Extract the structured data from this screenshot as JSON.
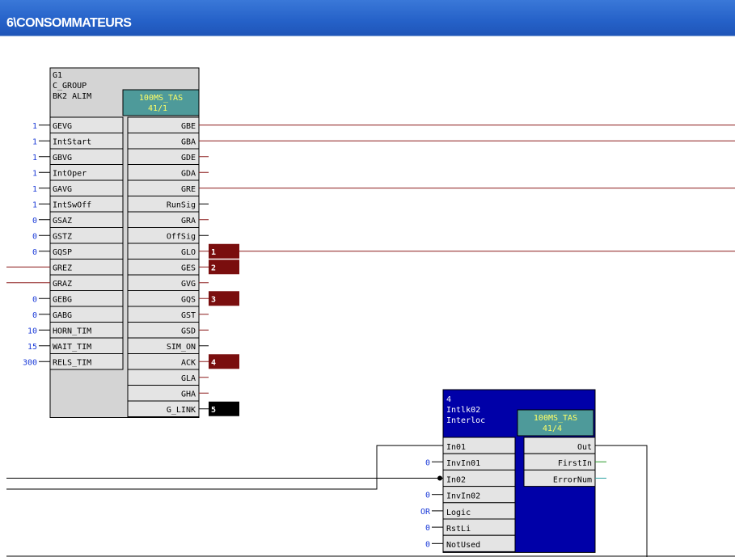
{
  "window": {
    "title": "6\\CONSOMMATEURS"
  },
  "blocks": {
    "g1": {
      "header": [
        "G1",
        "C_GROUP",
        "BK2 ALIM"
      ],
      "task": [
        "100MS_TAS",
        "41/1"
      ],
      "inputs": [
        {
          "name": "GEVG",
          "value": "1"
        },
        {
          "name": "IntStart",
          "value": "1"
        },
        {
          "name": "GBVG",
          "value": "1"
        },
        {
          "name": "IntOper",
          "value": "1"
        },
        {
          "name": "GAVG",
          "value": "1"
        },
        {
          "name": "IntSwOff",
          "value": "1"
        },
        {
          "name": "GSAZ",
          "value": "0"
        },
        {
          "name": "GSTZ",
          "value": "0"
        },
        {
          "name": "GQSP",
          "value": "0"
        },
        {
          "name": "GREZ",
          "value": ""
        },
        {
          "name": "GRAZ",
          "value": ""
        },
        {
          "name": "GEBG",
          "value": "0"
        },
        {
          "name": "GABG",
          "value": "0"
        },
        {
          "name": "HORN_TIM",
          "value": "10"
        },
        {
          "name": "WAIT_TIM",
          "value": "15"
        },
        {
          "name": "RELS_TIM",
          "value": "300"
        }
      ],
      "outputs": [
        "GBE",
        "GBA",
        "GDE",
        "GDA",
        "GRE",
        "RunSig",
        "GRA",
        "OffSig",
        "GLO",
        "GES",
        "GVG",
        "GQS",
        "GST",
        "GSD",
        "SIM_ON",
        "ACK",
        "GLA",
        "GHA",
        "G_LINK"
      ],
      "markers": [
        {
          "pin": "GLO",
          "label": "1"
        },
        {
          "pin": "GES",
          "label": "2"
        },
        {
          "pin": "GQS",
          "label": "3"
        },
        {
          "pin": "ACK",
          "label": "4"
        },
        {
          "pin": "G_LINK",
          "label": "5"
        }
      ]
    },
    "b4": {
      "header": [
        "4",
        "Intlk02",
        "Interloc"
      ],
      "task": [
        "100MS_TAS",
        "41/4"
      ],
      "inputs": [
        {
          "name": "In01",
          "value": ""
        },
        {
          "name": "InvIn01",
          "value": "0"
        },
        {
          "name": "In02",
          "value": ""
        },
        {
          "name": "InvIn02",
          "value": "0"
        },
        {
          "name": "Logic",
          "value": "OR"
        },
        {
          "name": "RstLi",
          "value": "0"
        },
        {
          "name": "NotUsed",
          "value": "0"
        }
      ],
      "outputs": [
        "Out",
        "FirstIn",
        "ErrorNum"
      ]
    }
  },
  "colors": {
    "titlebar": "#2561c8",
    "wire_red": "#8b1a1a",
    "marker_red": "#7a0e0e",
    "marker_black": "#000000",
    "block_bg": "#d4d4d4",
    "task_bg": "#4e9a9a",
    "task_text": "#ffff66",
    "value_blue": "#1a3ad8",
    "interlock_bg": "#0000a8",
    "wire_green": "#2a9a2a",
    "wire_teal": "#2aa0a0"
  }
}
